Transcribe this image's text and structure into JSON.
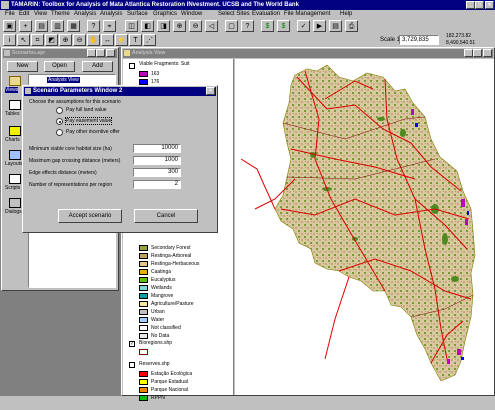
{
  "app": {
    "title": "TAMARIN: Toolbox for Analysis of Mata Atlantica Restoration INvestment. UCSB and The World Bank",
    "menu": [
      "File",
      "Edit",
      "View",
      "Theme",
      "Analysis",
      "Analysis",
      "Surface",
      "Graphics",
      "Window",
      "Select Sites",
      "Evaluation",
      "File Management",
      "Help"
    ],
    "scale_label": "Scale 1:",
    "scale_value": "3,729,835",
    "coord_x": "182,273.82",
    "coord_y": "8,490,540.51"
  },
  "scenarios_window": {
    "title": "Scenarios.apr",
    "buttons": [
      "New",
      "Open",
      "Add"
    ],
    "icon_labels": [
      "Views",
      "Tables",
      "Charts",
      "Layouts",
      "Scripts",
      "Dialogs"
    ],
    "doc_item": "Analysis View"
  },
  "dialog": {
    "title": "Scenario Parameters Window 2",
    "instruction": "Choose the assumptions for this scenario",
    "radio_options": [
      "Pay full land value",
      "Pay easement value",
      "Pay other incentive offer"
    ],
    "selected_index": 1,
    "fields": [
      {
        "label": "Minimum viable core habitat size (ha)",
        "value": "10000"
      },
      {
        "label": "Maximum gap crossing distance (meters)",
        "value": "1000"
      },
      {
        "label": "Edge effects distance (meters)",
        "value": "300"
      },
      {
        "label": "Number of representations per region",
        "value": "2"
      }
    ],
    "accept_label": "Accept scenario",
    "cancel_label": "Cancel"
  },
  "analysis_view": {
    "title": "Analysis View",
    "legend_top": {
      "theme": "Viable Fragments: Suit",
      "items": [
        {
          "label": "163",
          "color": "#c000c0"
        },
        {
          "label": "176",
          "color": "#0000ff"
        }
      ]
    },
    "landcover": [
      {
        "label": "Secondary Forest",
        "color": "#98a040"
      },
      {
        "label": "Restinga-Arboreal",
        "color": "#c0a060"
      },
      {
        "label": "Restinga-Herbaceous",
        "color": "#e0c890"
      },
      {
        "label": "Caatinga",
        "color": "#e8b000"
      },
      {
        "label": "Eucalyptus",
        "color": "#60c000"
      },
      {
        "label": "Wetlands",
        "color": "#80d8d8"
      },
      {
        "label": "Mangrove",
        "color": "#00a0a0"
      },
      {
        "label": "Agriculture/Pasture",
        "color": "#f0e8a0"
      },
      {
        "label": "Urban",
        "color": "#c0c0c0"
      },
      {
        "label": "Water",
        "color": "#a0d0ff"
      },
      {
        "label": "Not classified",
        "color": "#ffffff"
      },
      {
        "label": "No Data",
        "color": "#e8e8e8"
      }
    ],
    "bioregions_label": "Bioregions.shp",
    "reserves_label": "Reserves.shp",
    "reserves": [
      {
        "label": "Estação Ecológica",
        "color": "#ff0000"
      },
      {
        "label": "Parque Estadual",
        "color": "#ffff00"
      },
      {
        "label": "Parque Nacional",
        "color": "#ff8000"
      },
      {
        "label": "RPPN",
        "color": "#00c000"
      }
    ],
    "colors": {
      "roads": "#e00000",
      "land": "#d8c8a0",
      "forest": "#70a030",
      "highlight": "#c000c0"
    }
  }
}
